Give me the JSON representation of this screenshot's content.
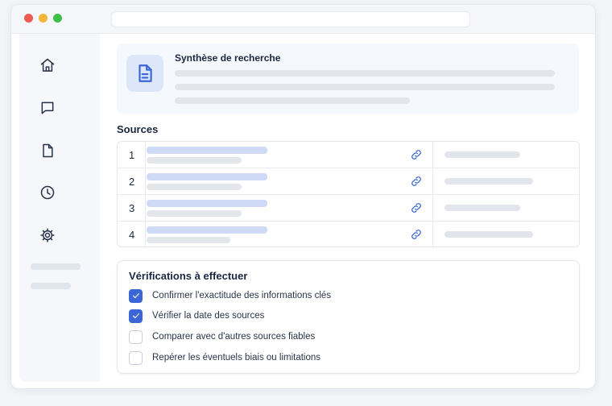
{
  "summary": {
    "title": "Synthèse de recherche",
    "icon": "document-icon"
  },
  "sidebar": {
    "items": [
      {
        "name": "home",
        "icon": "home-icon"
      },
      {
        "name": "messages",
        "icon": "chat-icon"
      },
      {
        "name": "documents",
        "icon": "file-icon"
      },
      {
        "name": "history",
        "icon": "clock-icon"
      },
      {
        "name": "settings",
        "icon": "gear-icon"
      }
    ]
  },
  "sources": {
    "title": "Sources",
    "rows": [
      {
        "number": "1",
        "icon": "link-icon"
      },
      {
        "number": "2",
        "icon": "link-icon"
      },
      {
        "number": "3",
        "icon": "link-icon"
      },
      {
        "number": "4",
        "icon": "link-icon"
      }
    ]
  },
  "verifications": {
    "title": "Vérifications à effectuer",
    "items": [
      {
        "label": "Confirmer l'exactitude des informations clés",
        "checked": true
      },
      {
        "label": "Vérifier la date des sources",
        "checked": true
      },
      {
        "label": "Comparer avec d'autres sources fiables",
        "checked": false
      },
      {
        "label": "Repérer les éventuels biais ou limitations",
        "checked": false
      }
    ]
  },
  "colors": {
    "accent": "#3a66d8",
    "accent_light": "#dde7fa",
    "text_primary": "#1b2740",
    "skeleton": "#e2e6ec",
    "link_skeleton": "#cfdaf7",
    "traffic_red": "#ef5a52",
    "traffic_yellow": "#f2b538",
    "traffic_green": "#3cc04a"
  }
}
